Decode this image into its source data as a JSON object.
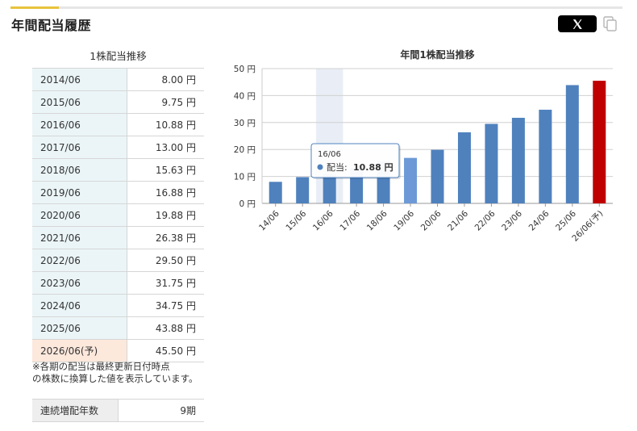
{
  "section": {
    "title": "年間配当履歴"
  },
  "share": {
    "x_label": "X"
  },
  "table": {
    "caption": "1株配当推移",
    "rows": [
      {
        "year": "2014/06",
        "value": "8.00 円"
      },
      {
        "year": "2015/06",
        "value": "9.75 円"
      },
      {
        "year": "2016/06",
        "value": "10.88 円"
      },
      {
        "year": "2017/06",
        "value": "13.00 円"
      },
      {
        "year": "2018/06",
        "value": "15.63 円"
      },
      {
        "year": "2019/06",
        "value": "16.88 円"
      },
      {
        "year": "2020/06",
        "value": "19.88 円"
      },
      {
        "year": "2021/06",
        "value": "26.38 円"
      },
      {
        "year": "2022/06",
        "value": "29.50 円"
      },
      {
        "year": "2023/06",
        "value": "31.75 円"
      },
      {
        "year": "2024/06",
        "value": "34.75 円"
      },
      {
        "year": "2025/06",
        "value": "43.88 円"
      },
      {
        "year": "2026/06(予)",
        "value": "45.50 円",
        "forecast": true
      }
    ],
    "note_line1": "※各期の配当は最終更新日付時点",
    "note_line2": "の株数に換算した値を表示しています。"
  },
  "streak": {
    "label": "連続増配年数",
    "value": "9期"
  },
  "colors": {
    "bar": "#4f81bd",
    "bar_hover": "#6d9ad6",
    "forecast": "#c00000",
    "grid": "#d0d0d0",
    "hover_band": "#e9eef6",
    "accent": "#e8c33d"
  },
  "chart_data": {
    "type": "bar",
    "title": "年間1株配当推移",
    "categories": [
      "14/06",
      "15/06",
      "16/06",
      "17/06",
      "18/06",
      "19/06",
      "20/06",
      "21/06",
      "22/06",
      "23/06",
      "24/06",
      "25/06",
      "26/06(予)"
    ],
    "values": [
      8.0,
      9.75,
      10.88,
      13.0,
      15.63,
      16.88,
      19.88,
      26.38,
      29.5,
      31.75,
      34.75,
      43.88,
      45.5
    ],
    "yticks": [
      "0 円",
      "10 円",
      "20 円",
      "30 円",
      "40 円",
      "50 円"
    ],
    "ylim": [
      0,
      50
    ],
    "grid": true,
    "forecast_index": 12,
    "hover_band_index": 2,
    "highlight_index": 5,
    "tooltip": {
      "index": 2,
      "header": "16/06",
      "series_label": "配当:",
      "value_text": "10.88 円"
    }
  }
}
